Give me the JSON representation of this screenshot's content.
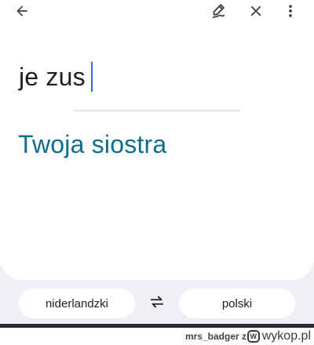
{
  "toolbar": {
    "back_icon": "arrow-left-icon",
    "handwriting_icon": "handwriting-pen-icon",
    "clear_icon": "close-icon",
    "more_icon": "more-vert-icon"
  },
  "source": {
    "text": "je zus"
  },
  "translation": {
    "text": "Twoja siostra"
  },
  "languages": {
    "source_label": "niderlandzki",
    "target_label": "polski",
    "swap_icon": "swap-arrows-icon"
  },
  "watermark": {
    "user_credit": "mrs_badger z",
    "site": "wykop.pl"
  },
  "colors": {
    "translation_text": "#0b6e8f",
    "caret": "#1a73e8",
    "background": "#eef0f6"
  }
}
